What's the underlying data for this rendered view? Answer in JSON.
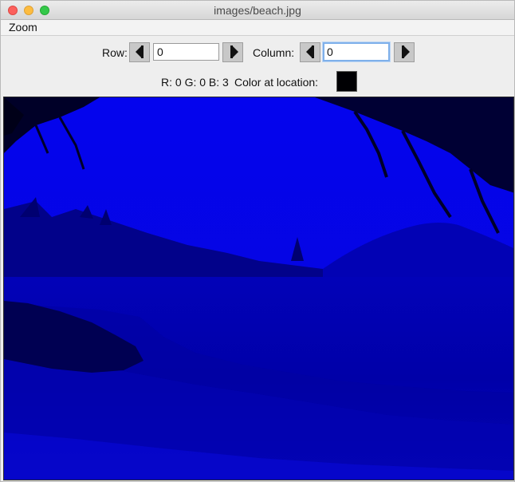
{
  "window": {
    "title": "images/beach.jpg"
  },
  "menu": {
    "items": [
      "Zoom"
    ]
  },
  "controls": {
    "row_label": "Row:",
    "row_value": "0",
    "column_label": "Column:",
    "column_value": "0",
    "rgb_readout": "R: 0 G: 0 B: 3",
    "color_label": "Color at location:",
    "color_swatch": "#000003"
  },
  "image": {
    "description_colors": {
      "sky": "#0606f0",
      "water": "#0000b4",
      "dark": "#000020"
    }
  }
}
